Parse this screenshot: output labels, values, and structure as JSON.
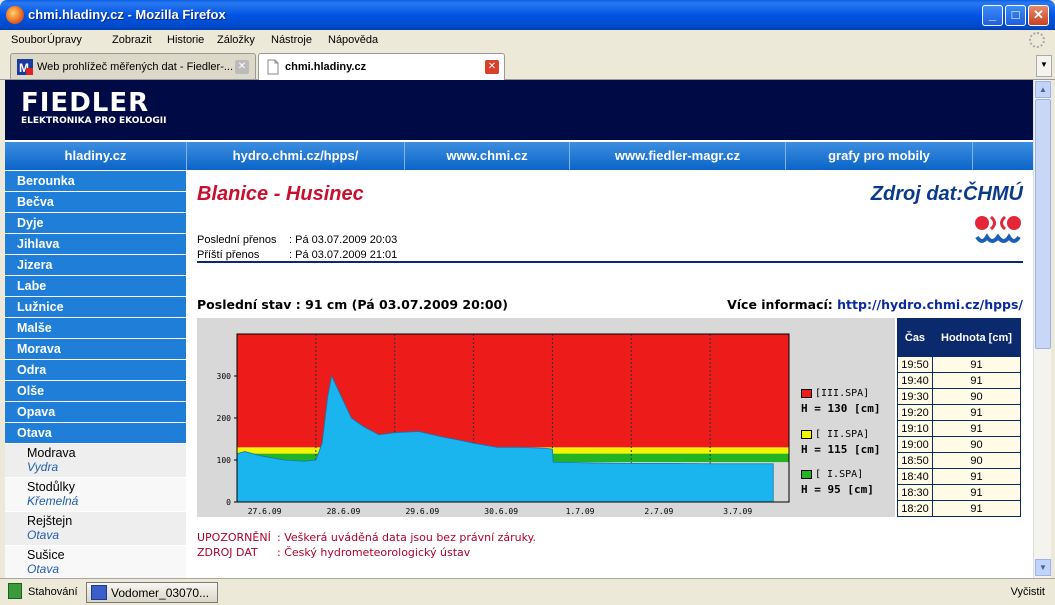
{
  "window": {
    "title": "chmi.hladiny.cz - Mozilla Firefox",
    "minimize": "_",
    "maximize": "□",
    "close": "✕"
  },
  "menu": [
    "Soubor",
    "Úpravy",
    "Zobrazit",
    "Historie",
    "Záložky",
    "Nástroje",
    "Nápověda"
  ],
  "tabs": [
    {
      "label": "Web prohlížeč měřených dat - Fiedler-...",
      "close": "✕",
      "icon": "m-favicon-icon"
    },
    {
      "label": "chmi.hladiny.cz",
      "close": "✕",
      "icon": "page-icon"
    }
  ],
  "tab_list_button": "▼",
  "brand": {
    "name": "FIEDLER",
    "tagline": "ELEKTRONIKA PRO EKOLOGII"
  },
  "topnav": [
    "hladiny.cz",
    "hydro.chmi.cz/hpps/",
    "www.chmi.cz",
    "www.fiedler-magr.cz",
    "grafy pro mobily"
  ],
  "sidebar": {
    "rivers": [
      "Berounka",
      "Bečva",
      "Dyje",
      "Jihlava",
      "Jizera",
      "Labe",
      "Lužnice",
      "Malše",
      "Morava",
      "Odra",
      "Olše",
      "Opava",
      "Otava"
    ],
    "stations": [
      {
        "name": "Modrava",
        "river": "Vydra"
      },
      {
        "name": "Stodůlky",
        "river": "Křemelná"
      },
      {
        "name": "Rejštejn",
        "river": "Otava"
      },
      {
        "name": "Sušice",
        "river": "Otava"
      }
    ]
  },
  "main": {
    "station_title": "Blanice - Husinec",
    "source_title": "Zdroj dat:ČHMÚ",
    "last_transfer_label": "Poslední přenos",
    "last_transfer_value": ": Pá 03.07.2009 20:03",
    "next_transfer_label": "Příští přenos",
    "next_transfer_value": ": Pá 03.07.2009 21:01",
    "last_state": "Poslední stav : 91 cm (Pá 03.07.2009 20:00)",
    "more_info_label": "Více informací: ",
    "more_info_link": "http://hydro.chmi.cz/hpps/",
    "warning_label": "UPOZORNĚNÍ",
    "warning_text": ": Veškerá uváděná data jsou bez právní záruky.",
    "source_label": "ZDROJ DAT",
    "source_text": ": Český hydrometeorologický ústav"
  },
  "legend": [
    {
      "label": "[III.SPA]",
      "h": "H = 130 [cm]",
      "color": "#ee1b1b"
    },
    {
      "label": "[ II.SPA]",
      "h": "H = 115 [cm]",
      "color": "#f4f400"
    },
    {
      "label": "[ I.SPA]",
      "h": "H = 95 [cm]",
      "color": "#22b422"
    }
  ],
  "table": {
    "headers": [
      "Čas",
      "Hodnota [cm]"
    ],
    "rows": [
      [
        "19:50",
        "91"
      ],
      [
        "19:40",
        "91"
      ],
      [
        "19:30",
        "90"
      ],
      [
        "19:20",
        "91"
      ],
      [
        "19:10",
        "91"
      ],
      [
        "19:00",
        "90"
      ],
      [
        "18:50",
        "90"
      ],
      [
        "18:40",
        "91"
      ],
      [
        "18:30",
        "91"
      ],
      [
        "18:20",
        "91"
      ]
    ]
  },
  "chart_data": {
    "type": "area",
    "title": "",
    "xlabel": "",
    "ylabel": "",
    "x_ticks": [
      "27.6.09",
      "28.6.09",
      "29.6.09",
      "30.6.09",
      "1.7.09",
      "2.7.09",
      "3.7.09"
    ],
    "y_ticks": [
      0,
      100,
      200,
      300
    ],
    "ylim": [
      0,
      400
    ],
    "thresholds": [
      {
        "name": "I.SPA",
        "value": 95,
        "color": "#22b422"
      },
      {
        "name": "II.SPA",
        "value": 115,
        "color": "#f4f400"
      },
      {
        "name": "III.SPA",
        "value": 130,
        "color": "#ee1b1b"
      }
    ],
    "series": [
      {
        "color": "#1ab4ee",
        "x_days": [
          0.0,
          0.1,
          0.3,
          0.6,
          0.85,
          1.0,
          1.08,
          1.15,
          1.2,
          1.3,
          1.45,
          1.6,
          1.8,
          2.0,
          2.3,
          2.6,
          2.8,
          3.0,
          3.3,
          3.6,
          3.9,
          4.0,
          4.01,
          4.5,
          5.0,
          5.5,
          6.0,
          6.5,
          6.8
        ],
        "values": [
          115,
          120,
          110,
          100,
          97,
          100,
          140,
          250,
          300,
          260,
          200,
          180,
          160,
          165,
          168,
          155,
          148,
          140,
          130,
          130,
          128,
          126,
          95,
          93,
          92,
          92,
          91,
          91,
          91
        ]
      }
    ]
  },
  "status": {
    "text": "Stahování",
    "task": "Vodomer_03070...",
    "clear": "Vyčistit"
  }
}
